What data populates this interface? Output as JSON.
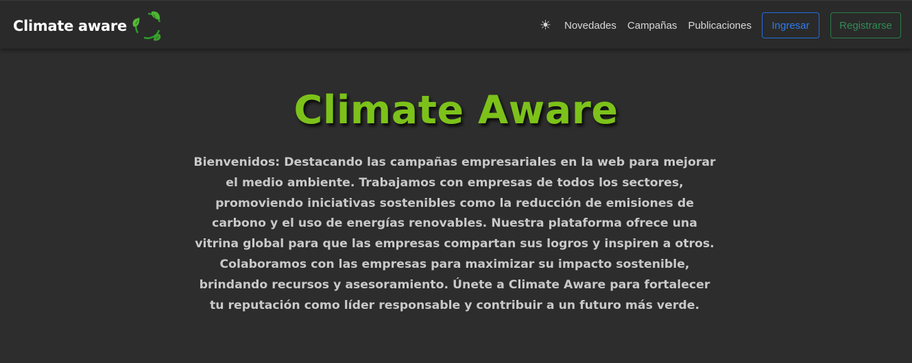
{
  "navbar": {
    "brand": "Climate aware",
    "logo_icon": "recycle-leaves-icon",
    "theme_toggle": "☀",
    "links": [
      "Novedades",
      "Campañas",
      "Publicaciones"
    ],
    "login_label": "Ingresar",
    "register_label": "Registrarse"
  },
  "hero": {
    "title": "Climate Aware",
    "description": "Bienvenidos: Destacando las campañas empresariales en la web para mejorar el medio ambiente. Trabajamos con empresas de todos los sectores, promoviendo iniciativas sostenibles como la reducción de emisiones de carbono y el uso de energías renovables. Nuestra plataforma ofrece una vitrina global para que las empresas compartan sus logros y inspiren a otros. Colaboramos con las empresas para maximizar su impacto sostenible, brindando recursos y asesoramiento. Únete a Climate Aware para fortalecer tu reputación como líder responsable y contribuir a un futuro más verde."
  },
  "colors": {
    "background": "#2d2d2d",
    "navbar": "#2a2a2a",
    "title_green": "#7cc21a",
    "login_blue": "#2f7bef",
    "register_green": "#2f8d55"
  }
}
